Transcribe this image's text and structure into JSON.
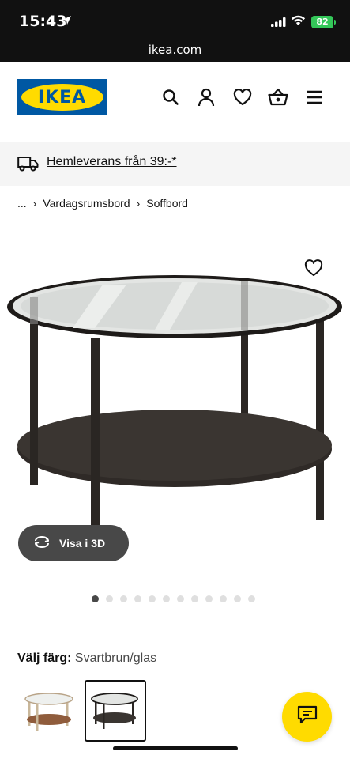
{
  "status_bar": {
    "time": "15:43",
    "battery": "82"
  },
  "url_bar": {
    "domain": "ikea.com"
  },
  "header": {
    "logo_text": "IKEA",
    "icons": [
      "search-icon",
      "account-icon",
      "heart-icon",
      "basket-icon",
      "menu-icon"
    ],
    "brand_blue": "#0058a3",
    "brand_yellow": "#ffdb00"
  },
  "delivery_banner": {
    "text": "Hemleverans från 39:-*",
    "icon": "truck-icon"
  },
  "breadcrumb": {
    "ellipsis": "...",
    "items": [
      "Vardagsrumsbord",
      "Soffbord"
    ]
  },
  "product": {
    "view_3d_label": "Visa i 3D",
    "carousel_total": 12,
    "carousel_active_index": 0
  },
  "color_selector": {
    "label": "Välj färg:",
    "value": "Svartbrun/glas",
    "options": [
      "Valnöt/glas",
      "Svartbrun/glas"
    ],
    "selected_index": 1
  },
  "chat_button": {
    "icon": "chat-icon"
  }
}
